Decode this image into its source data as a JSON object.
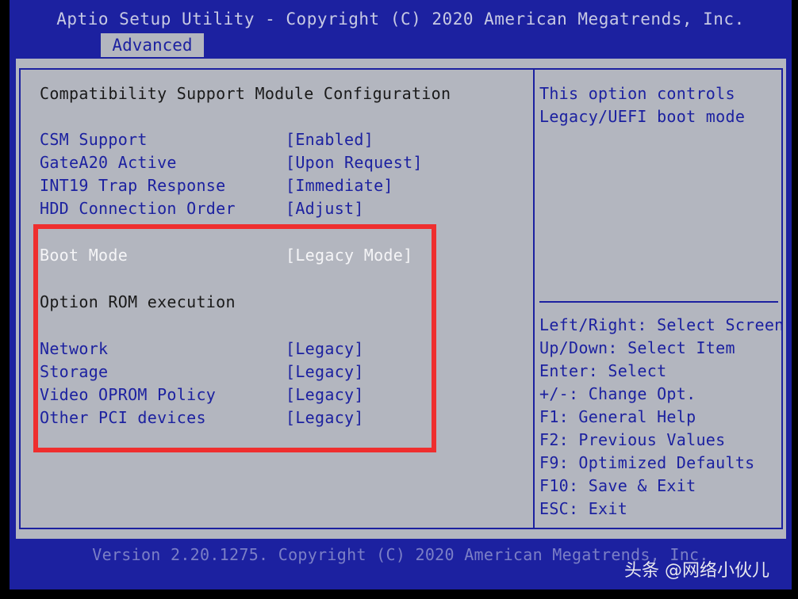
{
  "header": {
    "title": "Aptio Setup Utility - Copyright (C) 2020 American Megatrends, Inc.",
    "active_tab": "Advanced"
  },
  "main": {
    "section_title": "Compatibility Support Module Configuration",
    "settings_top": [
      {
        "label": "CSM Support",
        "value": "[Enabled]"
      },
      {
        "label": "GateA20 Active",
        "value": "[Upon Request]"
      },
      {
        "label": "INT19 Trap Response",
        "value": "[Immediate]"
      },
      {
        "label": "HDD Connection Order",
        "value": "[Adjust]"
      }
    ],
    "boot_mode": {
      "label": "Boot Mode",
      "value": "[Legacy Mode]"
    },
    "option_rom_heading": "Option ROM execution",
    "option_rom_items": [
      {
        "label": "Network",
        "value": "[Legacy]"
      },
      {
        "label": "Storage",
        "value": "[Legacy]"
      },
      {
        "label": "Video OPROM Policy",
        "value": "[Legacy]"
      },
      {
        "label": "Other PCI devices",
        "value": "[Legacy]"
      }
    ]
  },
  "help_panel": {
    "description_line1": "This option controls",
    "description_line2": "Legacy/UEFI boot mode",
    "keys": [
      "Left/Right: Select Screen",
      "Up/Down: Select Item",
      "Enter: Select",
      "+/-: Change Opt.",
      "F1: General Help",
      "F2: Previous Values",
      "F9: Optimized Defaults",
      "F10: Save & Exit",
      "ESC: Exit"
    ]
  },
  "footer": {
    "version": "Version 2.20.1275. Copyright (C) 2020 American Megatrends, Inc."
  },
  "watermark": {
    "text": "头条 @网络小伙儿"
  },
  "colors": {
    "bios_blue": "#1c21a0",
    "panel_gray": "#b3b6bf",
    "highlight_red": "#ef2e2e",
    "selected_white": "#f5f5f7"
  }
}
